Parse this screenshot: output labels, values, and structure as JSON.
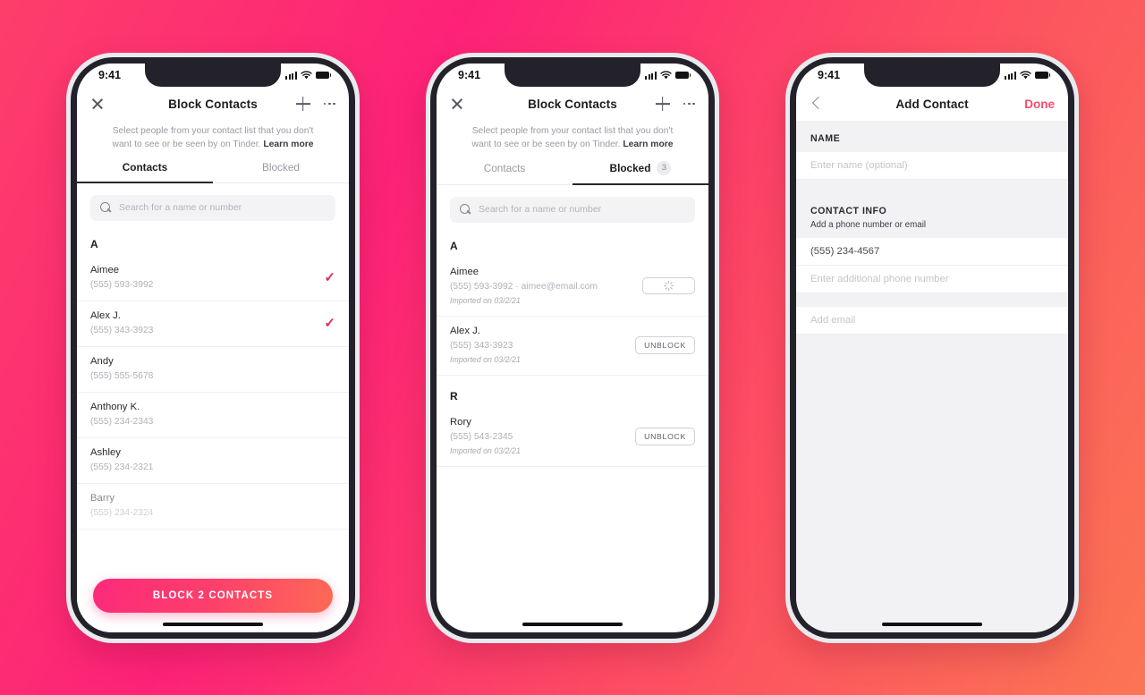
{
  "background": {
    "gradient_from": "#FD2277",
    "gradient_to": "#FB7553"
  },
  "accent": {
    "brand_pink": "#FD2A7B",
    "brand_orange": "#FD6A55",
    "check": "#E0295C",
    "done": "#FB4A68"
  },
  "phones": [
    {
      "id": "block-contacts-contacts-tab",
      "status_bar": {
        "time": "9:41",
        "signal_icon": "cellular-bars-icon",
        "wifi_icon": "wifi-icon",
        "battery_icon": "battery-icon"
      },
      "navbar": {
        "close_icon": "close-icon",
        "title": "Block Contacts",
        "add_icon": "plus-icon",
        "more_icon": "more-options-icon"
      },
      "subtitle": {
        "text": "Select people from your contact list that you don't want to see or be seen by on Tinder. ",
        "link": "Learn more"
      },
      "tabs": [
        {
          "label": "Contacts",
          "active": true,
          "badge": ""
        },
        {
          "label": "Blocked",
          "active": false,
          "badge": ""
        }
      ],
      "search": {
        "placeholder": "Search for a name or number",
        "icon": "search-icon",
        "value": ""
      },
      "sections": [
        {
          "letter": "A",
          "rows": [
            {
              "name": "Aimee",
              "sub": "(555) 593-3992",
              "meta": "",
              "action": "check",
              "action_label": "✓",
              "faded": false
            },
            {
              "name": "Alex J.",
              "sub": "(555) 343-3923",
              "meta": "",
              "action": "check",
              "action_label": "✓",
              "faded": false
            },
            {
              "name": "Andy",
              "sub": "(555) 555-5678",
              "meta": "",
              "action": "none",
              "action_label": "",
              "faded": false
            },
            {
              "name": "Anthony K.",
              "sub": "(555) 234-2343",
              "meta": "",
              "action": "none",
              "action_label": "",
              "faded": false
            },
            {
              "name": "Ashley",
              "sub": "(555) 234-2321",
              "meta": "",
              "action": "none",
              "action_label": "",
              "faded": false
            },
            {
              "name": "Barry",
              "sub": "(555) 234-2324",
              "meta": "",
              "action": "none",
              "action_label": "",
              "faded": true
            }
          ]
        }
      ],
      "cta": {
        "label": "BLOCK 2 CONTACTS"
      }
    },
    {
      "id": "block-contacts-blocked-tab",
      "status_bar": {
        "time": "9:41",
        "signal_icon": "cellular-bars-icon",
        "wifi_icon": "wifi-icon",
        "battery_icon": "battery-icon"
      },
      "navbar": {
        "close_icon": "close-icon",
        "title": "Block Contacts",
        "add_icon": "plus-icon",
        "more_icon": "more-options-icon"
      },
      "subtitle": {
        "text": "Select people from your contact list that you don't want to see or be seen by on Tinder. ",
        "link": "Learn more"
      },
      "tabs": [
        {
          "label": "Contacts",
          "active": false,
          "badge": ""
        },
        {
          "label": "Blocked",
          "active": true,
          "badge": "3"
        }
      ],
      "search": {
        "placeholder": "Search for a name or number",
        "icon": "search-icon",
        "value": ""
      },
      "sections": [
        {
          "letter": "A",
          "rows": [
            {
              "name": "Aimee",
              "sub": "(555) 593-3992  ·  aimee@email.com",
              "meta": "Imported on 03/2/21",
              "action": "spinner",
              "action_label": "",
              "faded": false
            },
            {
              "name": "Alex J.",
              "sub": "(555) 343-3923",
              "meta": "Imported on 03/2/21",
              "action": "button",
              "action_label": "UNBLOCK",
              "faded": false
            }
          ]
        },
        {
          "letter": "R",
          "rows": [
            {
              "name": "Rory",
              "sub": "(555) 543-2345",
              "meta": "Imported on 03/2/21",
              "action": "button",
              "action_label": "UNBLOCK",
              "faded": false
            }
          ]
        }
      ],
      "cta": null
    }
  ],
  "add_contact": {
    "id": "add-contact",
    "status_bar": {
      "time": "9:41",
      "signal_icon": "cellular-bars-icon",
      "wifi_icon": "wifi-icon",
      "battery_icon": "battery-icon"
    },
    "navbar": {
      "back_icon": "chevron-left-icon",
      "title": "Add Contact",
      "done_label": "Done"
    },
    "name_section": {
      "header": "NAME",
      "field_placeholder": "Enter name (optional)",
      "field_value": ""
    },
    "contact_section": {
      "header": "CONTACT INFO",
      "description": "Add a phone number or email",
      "phone_primary_value": "(555) 234-4567",
      "phone_additional_placeholder": "Enter additional phone number",
      "email_placeholder": "Add email"
    }
  }
}
